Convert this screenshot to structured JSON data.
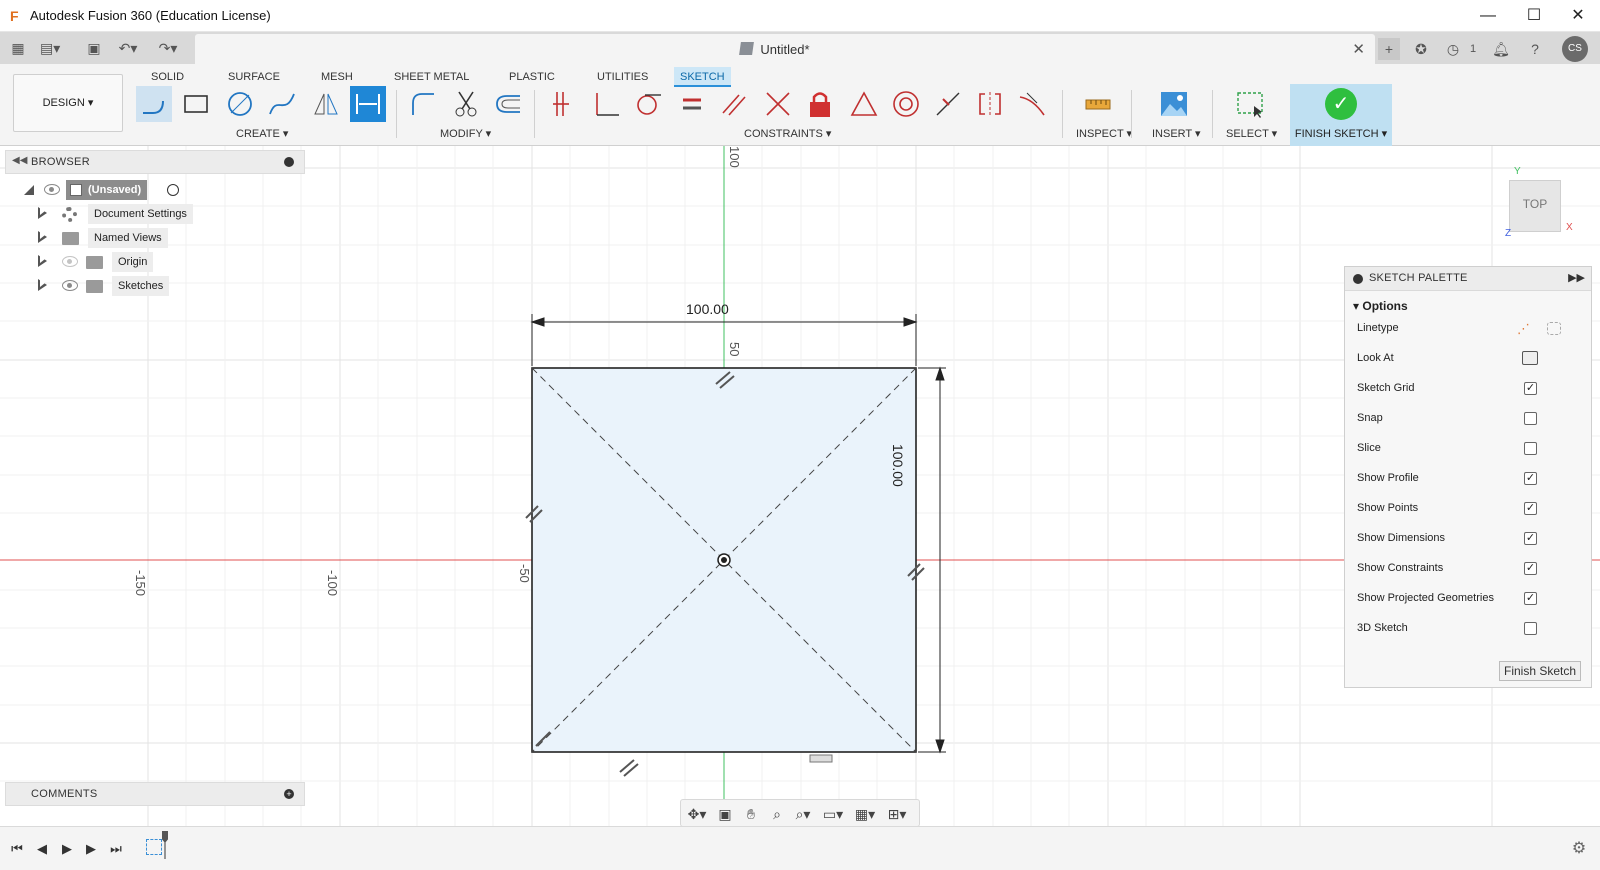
{
  "window": {
    "title": "Autodesk Fusion 360 (Education License)",
    "minimize": "—",
    "maximize": "☐",
    "close": "✕"
  },
  "document_tab": {
    "title": "Untitled*",
    "close": "✕"
  },
  "user": {
    "initials": "CS"
  },
  "job_status": {
    "count": "1"
  },
  "ribbon": {
    "workspace": "DESIGN ▾",
    "tabs": [
      "SOLID",
      "SURFACE",
      "MESH",
      "SHEET METAL",
      "PLASTIC",
      "UTILITIES",
      "SKETCH"
    ],
    "active_tab": "SKETCH",
    "groups": {
      "create": "CREATE ▾",
      "modify": "MODIFY ▾",
      "constraints": "CONSTRAINTS ▾",
      "inspect": "INSPECT ▾",
      "insert": "INSERT ▾",
      "select": "SELECT ▾",
      "finish": "FINISH SKETCH ▾"
    }
  },
  "browser": {
    "title": "BROWSER",
    "root": "(Unsaved)",
    "items": [
      "Document Settings",
      "Named Views",
      "Origin",
      "Sketches"
    ]
  },
  "comments": {
    "title": "COMMENTS"
  },
  "canvas": {
    "ruler_labels": {
      "top": "100",
      "mid": "50",
      "x_minus_150": "-150",
      "x_minus_100": "-100",
      "x_minus_50": "-50"
    },
    "dimension_horizontal": "100.00",
    "dimension_vertical": "100.00",
    "viewcube_label": "TOP",
    "axis_labels": {
      "y": "Y",
      "x": "X",
      "z": "Z"
    }
  },
  "sketch_palette": {
    "title": "SKETCH PALETTE",
    "section": "Options",
    "linetype_label": "Linetype",
    "look_at_label": "Look At",
    "options": [
      {
        "label": "Sketch Grid",
        "checked": true
      },
      {
        "label": "Snap",
        "checked": false
      },
      {
        "label": "Slice",
        "checked": false
      },
      {
        "label": "Show Profile",
        "checked": true
      },
      {
        "label": "Show Points",
        "checked": true
      },
      {
        "label": "Show Dimensions",
        "checked": true
      },
      {
        "label": "Show Constraints",
        "checked": true
      },
      {
        "label": "Show Projected Geometries",
        "checked": true
      },
      {
        "label": "3D Sketch",
        "checked": false
      }
    ],
    "finish_button": "Finish Sketch"
  },
  "colors": {
    "accent": "#1f87d6",
    "finish_green": "#2fbf3f",
    "x_axis": "#e05050",
    "y_axis": "#40c060",
    "profile_fill": "#eaf3fb"
  }
}
